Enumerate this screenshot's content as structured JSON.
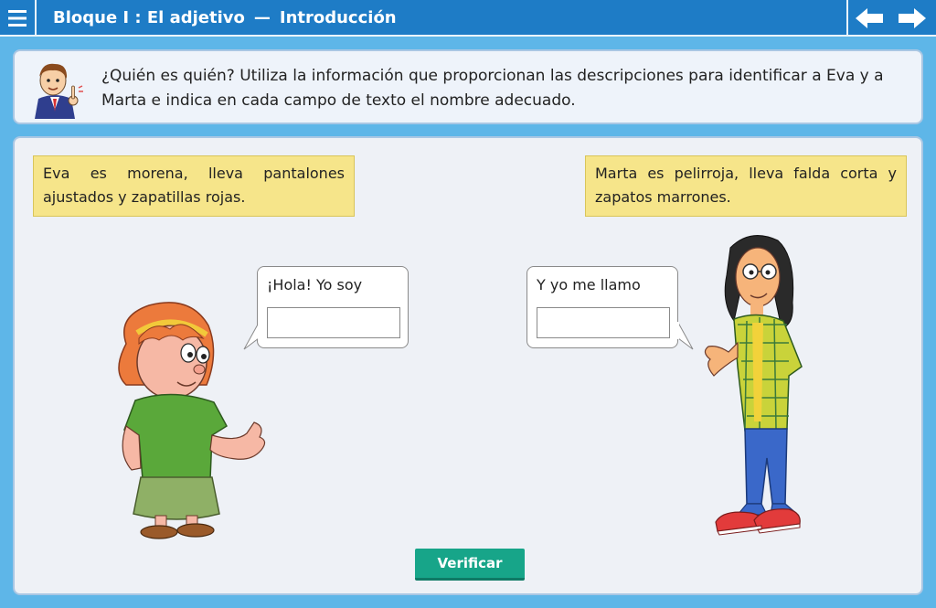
{
  "header": {
    "block": "Bloque I : El adjetivo",
    "separator": "—",
    "section": "Introducción"
  },
  "instruction": {
    "text": "¿Quién es quién? Utiliza la información que proporcionan las descripciones para identificar a Eva y a Marta e indica en cada campo de texto el nombre adecuado."
  },
  "notes": {
    "eva": "Eva es morena, lleva pantalones ajustados y zapatillas rojas.",
    "marta": "Marta es pelirroja, lleva falda corta y zapatos marrones."
  },
  "bubbles": {
    "left": {
      "label": "¡Hola! Yo soy",
      "value": ""
    },
    "right": {
      "label": "Y yo me llamo",
      "value": ""
    }
  },
  "buttons": {
    "verify": "Verificar"
  },
  "icons": {
    "menu": "menu-icon",
    "prev": "arrow-left-icon",
    "next": "arrow-right-icon"
  },
  "colors": {
    "header": "#1e7cc6",
    "background": "#5eb6e8",
    "note": "#f6e58a",
    "verify": "#17a589"
  }
}
